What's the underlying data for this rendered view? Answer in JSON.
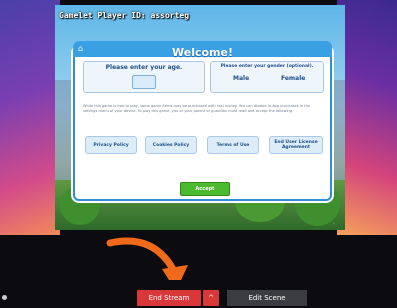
{
  "overlay": {
    "title": "Gamelet Player ID: assorteg"
  },
  "dialog": {
    "title": "Welcome!",
    "age_label": "Please enter your age.",
    "gender_label": "Please enter your gender (optional).",
    "gender_options": [
      "Male",
      "Female"
    ],
    "notice": "While this game is free to play, some game items may be purchased with real money. You can disable in-app purchases in the settings menu of your device. To play this game, you or your parent or guardian must read and accept the following.",
    "policies": [
      "Privacy Policy",
      "Cookies Policy",
      "Terms of Use",
      "End User License Agreement"
    ],
    "accept_label": "Accept"
  },
  "controls": {
    "end_stream": "End Stream",
    "caret": "^",
    "edit_scene": "Edit Scene"
  },
  "colors": {
    "accent": "#d9383a",
    "dialog_blue": "#3aa0e4",
    "accept_green": "#4cba2f"
  }
}
